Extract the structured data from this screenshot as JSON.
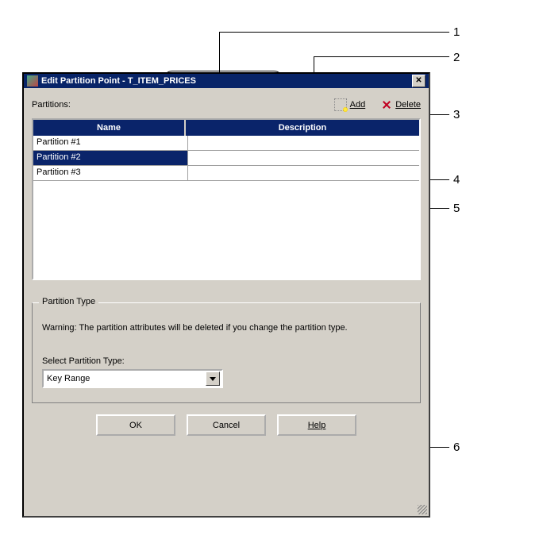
{
  "window": {
    "title": "Edit Partition Point - T_ITEM_PRICES"
  },
  "toolbar": {
    "partitions_label": "Partitions:",
    "add_label": "Add",
    "delete_label": "Delete"
  },
  "table": {
    "col_name": "Name",
    "col_desc": "Description",
    "rows": [
      {
        "name": "Partition #1",
        "desc": ""
      },
      {
        "name": "Partition #2",
        "desc": ""
      },
      {
        "name": "Partition #3",
        "desc": ""
      }
    ],
    "selected_index": 1
  },
  "group": {
    "title": "Partition Type",
    "warning": "Warning: The partition attributes will be deleted if you change the partition type.",
    "select_label": "Select Partition Type:",
    "combo_value": "Key Range"
  },
  "buttons": {
    "ok": "OK",
    "cancel": "Cancel",
    "help": "Help"
  },
  "callouts": {
    "1": "1",
    "2": "2",
    "3": "3",
    "4": "4",
    "5": "5",
    "6": "6"
  }
}
